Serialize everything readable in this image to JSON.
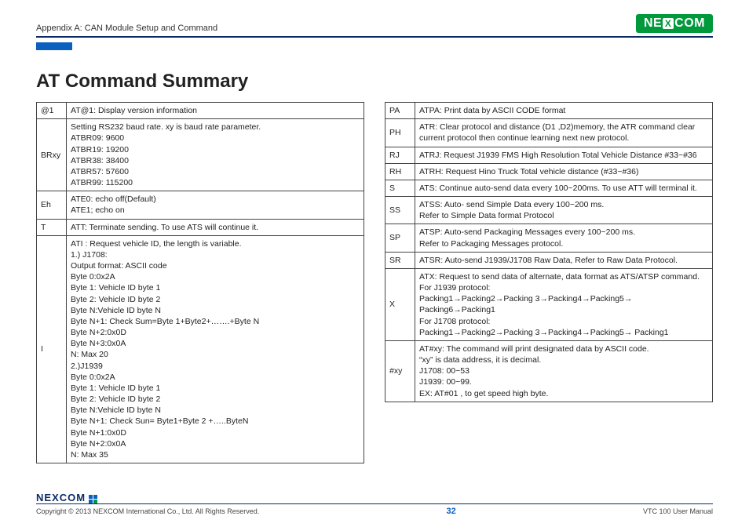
{
  "header": {
    "appendix": "Appendix A: CAN Module Setup and Command",
    "logo_pre": "NE",
    "logo_x": "X",
    "logo_post": "COM"
  },
  "heading": "AT Command Summary",
  "left_rows": [
    {
      "k": "@1",
      "v": "AT@1: Display version information"
    },
    {
      "k": "BRxy",
      "v": "Setting RS232 baud rate. xy is baud rate parameter.\nATBR09: 9600\nATBR19: 19200\nATBR38: 38400\nATBR57: 57600\nATBR99: 115200"
    },
    {
      "k": "Eh",
      "v": "ATE0: echo off(Default)\nATE1; echo on"
    },
    {
      "k": "T",
      "v": "ATT: Terminate sending. To use ATS will continue it."
    },
    {
      "k": "I",
      "v": "ATI : Request vehicle ID, the length is variable.\n1.) J1708:\nOutput format: ASCII code\nByte 0:0x2A\nByte 1: Vehicle ID byte 1\nByte 2: Vehicle ID byte 2\nByte N:Vehicle ID byte N\nByte N+1: Check Sum=Byte 1+Byte2+…….+Byte N\nByte N+2:0x0D\nByte N+3:0x0A\nN: Max 20\n2.)J1939\nByte 0:0x2A\nByte 1: Vehicle ID byte 1\nByte 2: Vehicle ID byte 2\nByte N:Vehicle ID byte N\nByte N+1: Check Sun= Byte1+Byte 2 +…..ByteN\nByte N+1:0x0D\nByte N+2:0x0A\nN: Max 35"
    }
  ],
  "right_rows": [
    {
      "k": "PA",
      "v": "ATPA: Print data by ASCII CODE format"
    },
    {
      "k": "PH",
      "v": "ATR: Clear protocol and distance (D1 ,D2)memory, the ATR command clear current protocol then continue learning next new protocol."
    },
    {
      "k": "RJ",
      "v": "ATRJ: Request J1939 FMS High Resolution Total Vehicle Distance #33~#36"
    },
    {
      "k": "RH",
      "v": "ATRH: Request Hino Truck Total vehicle distance (#33~#36)"
    },
    {
      "k": "S",
      "v": "ATS: Continue auto-send data every 100~200ms. To use ATT will terminal it."
    },
    {
      "k": "SS",
      "v": "ATSS: Auto- send Simple Data every 100~200 ms.\nRefer to Simple Data format Protocol"
    },
    {
      "k": "SP",
      "v": "ATSP: Auto-send Packaging Messages every 100~200 ms.\nRefer to Packaging Messages protocol."
    },
    {
      "k": "SR",
      "v": "ATSR: Auto-send J1939/J1708 Raw Data, Refer to Raw Data Protocol."
    },
    {
      "k": "X",
      "v": "ATX: Request to send data of alternate, data format as ATS/ATSP command.\nFor J1939 protocol:\nPacking1→Packing2→Packing 3→Packing4→Packing5→ Packing6→Packing1\nFor J1708 protocol:\nPacking1→Packing2→Packing 3→Packing4→Packing5→ Packing1"
    },
    {
      "k": "#xy",
      "v": "AT#xy: The command will print designated data by ASCII code.\n“xy” is data address, it is decimal.\nJ1708: 00~53\nJ1939: 00~99.\nEX: AT#01 , to get speed high byte."
    }
  ],
  "footer": {
    "copyright": "Copyright © 2013 NEXCOM International Co., Ltd. All Rights Reserved.",
    "page_number": "32",
    "doc": "VTC 100 User Manual",
    "logo_text": "NE",
    "logo_x": "X",
    "logo_post": "COM"
  }
}
